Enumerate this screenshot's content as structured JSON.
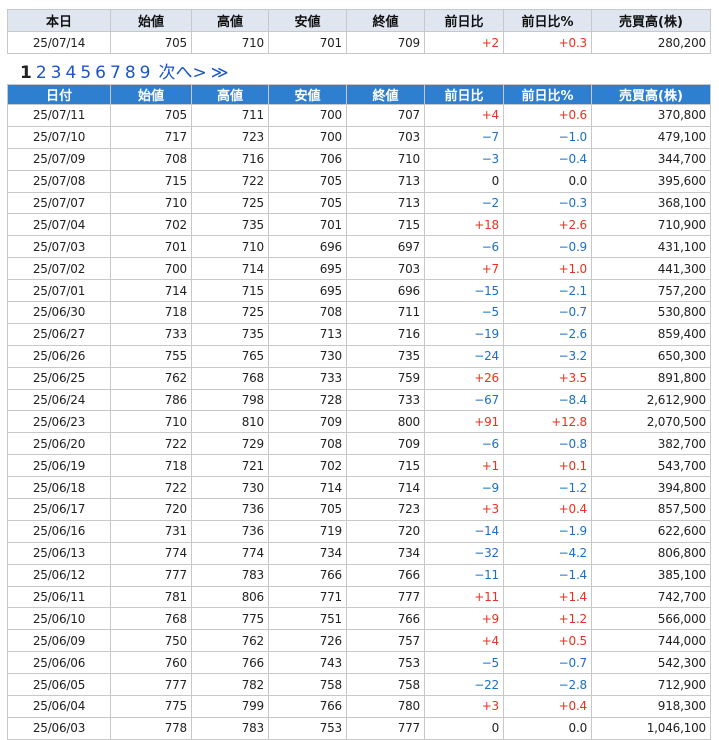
{
  "colors": {
    "positive": "#e8321e",
    "negative": "#1b6fc7",
    "header_blue": "#2f7fd0",
    "header_light": "#dfe6f0"
  },
  "today": {
    "headers": [
      "本日",
      "始値",
      "高値",
      "安値",
      "終値",
      "前日比",
      "前日比%",
      "売買高(株)"
    ],
    "row": [
      "25/07/14",
      "705",
      "710",
      "701",
      "709",
      "+2",
      "+0.3",
      "280,200"
    ]
  },
  "pager": {
    "current": "1",
    "pages": [
      "2",
      "3",
      "4",
      "5",
      "6",
      "7",
      "8",
      "9"
    ],
    "next_label": "次へ>",
    "last_label": "≫"
  },
  "history": {
    "headers": [
      "日付",
      "始値",
      "高値",
      "安値",
      "終値",
      "前日比",
      "前日比%",
      "売買高(株)"
    ],
    "rows": [
      [
        "25/07/11",
        "705",
        "711",
        "700",
        "707",
        "+4",
        "+0.6",
        "370,800"
      ],
      [
        "25/07/10",
        "717",
        "723",
        "700",
        "703",
        "-7",
        "-1.0",
        "479,100"
      ],
      [
        "25/07/09",
        "708",
        "716",
        "706",
        "710",
        "-3",
        "-0.4",
        "344,700"
      ],
      [
        "25/07/08",
        "715",
        "722",
        "705",
        "713",
        "0",
        "0.0",
        "395,600"
      ],
      [
        "25/07/07",
        "710",
        "725",
        "705",
        "713",
        "-2",
        "-0.3",
        "368,100"
      ],
      [
        "25/07/04",
        "702",
        "735",
        "701",
        "715",
        "+18",
        "+2.6",
        "710,900"
      ],
      [
        "25/07/03",
        "701",
        "710",
        "696",
        "697",
        "-6",
        "-0.9",
        "431,100"
      ],
      [
        "25/07/02",
        "700",
        "714",
        "695",
        "703",
        "+7",
        "+1.0",
        "441,300"
      ],
      [
        "25/07/01",
        "714",
        "715",
        "695",
        "696",
        "-15",
        "-2.1",
        "757,200"
      ],
      [
        "25/06/30",
        "718",
        "725",
        "708",
        "711",
        "-5",
        "-0.7",
        "530,800"
      ],
      [
        "25/06/27",
        "733",
        "735",
        "713",
        "716",
        "-19",
        "-2.6",
        "859,400"
      ],
      [
        "25/06/26",
        "755",
        "765",
        "730",
        "735",
        "-24",
        "-3.2",
        "650,300"
      ],
      [
        "25/06/25",
        "762",
        "768",
        "733",
        "759",
        "+26",
        "+3.5",
        "891,800"
      ],
      [
        "25/06/24",
        "786",
        "798",
        "728",
        "733",
        "-67",
        "-8.4",
        "2,612,900"
      ],
      [
        "25/06/23",
        "710",
        "810",
        "709",
        "800",
        "+91",
        "+12.8",
        "2,070,500"
      ],
      [
        "25/06/20",
        "722",
        "729",
        "708",
        "709",
        "-6",
        "-0.8",
        "382,700"
      ],
      [
        "25/06/19",
        "718",
        "721",
        "702",
        "715",
        "+1",
        "+0.1",
        "543,700"
      ],
      [
        "25/06/18",
        "722",
        "730",
        "714",
        "714",
        "-9",
        "-1.2",
        "394,800"
      ],
      [
        "25/06/17",
        "720",
        "736",
        "705",
        "723",
        "+3",
        "+0.4",
        "857,500"
      ],
      [
        "25/06/16",
        "731",
        "736",
        "719",
        "720",
        "-14",
        "-1.9",
        "622,600"
      ],
      [
        "25/06/13",
        "774",
        "774",
        "734",
        "734",
        "-32",
        "-4.2",
        "806,800"
      ],
      [
        "25/06/12",
        "777",
        "783",
        "766",
        "766",
        "-11",
        "-1.4",
        "385,100"
      ],
      [
        "25/06/11",
        "781",
        "806",
        "771",
        "777",
        "+11",
        "+1.4",
        "742,700"
      ],
      [
        "25/06/10",
        "768",
        "775",
        "751",
        "766",
        "+9",
        "+1.2",
        "566,000"
      ],
      [
        "25/06/09",
        "750",
        "762",
        "726",
        "757",
        "+4",
        "+0.5",
        "744,000"
      ],
      [
        "25/06/06",
        "760",
        "766",
        "743",
        "753",
        "-5",
        "-0.7",
        "542,300"
      ],
      [
        "25/06/05",
        "777",
        "782",
        "758",
        "758",
        "-22",
        "-2.8",
        "712,900"
      ],
      [
        "25/06/04",
        "775",
        "799",
        "766",
        "780",
        "+3",
        "+0.4",
        "918,300"
      ],
      [
        "25/06/03",
        "778",
        "783",
        "753",
        "777",
        "0",
        "0.0",
        "1,046,100"
      ]
    ]
  }
}
